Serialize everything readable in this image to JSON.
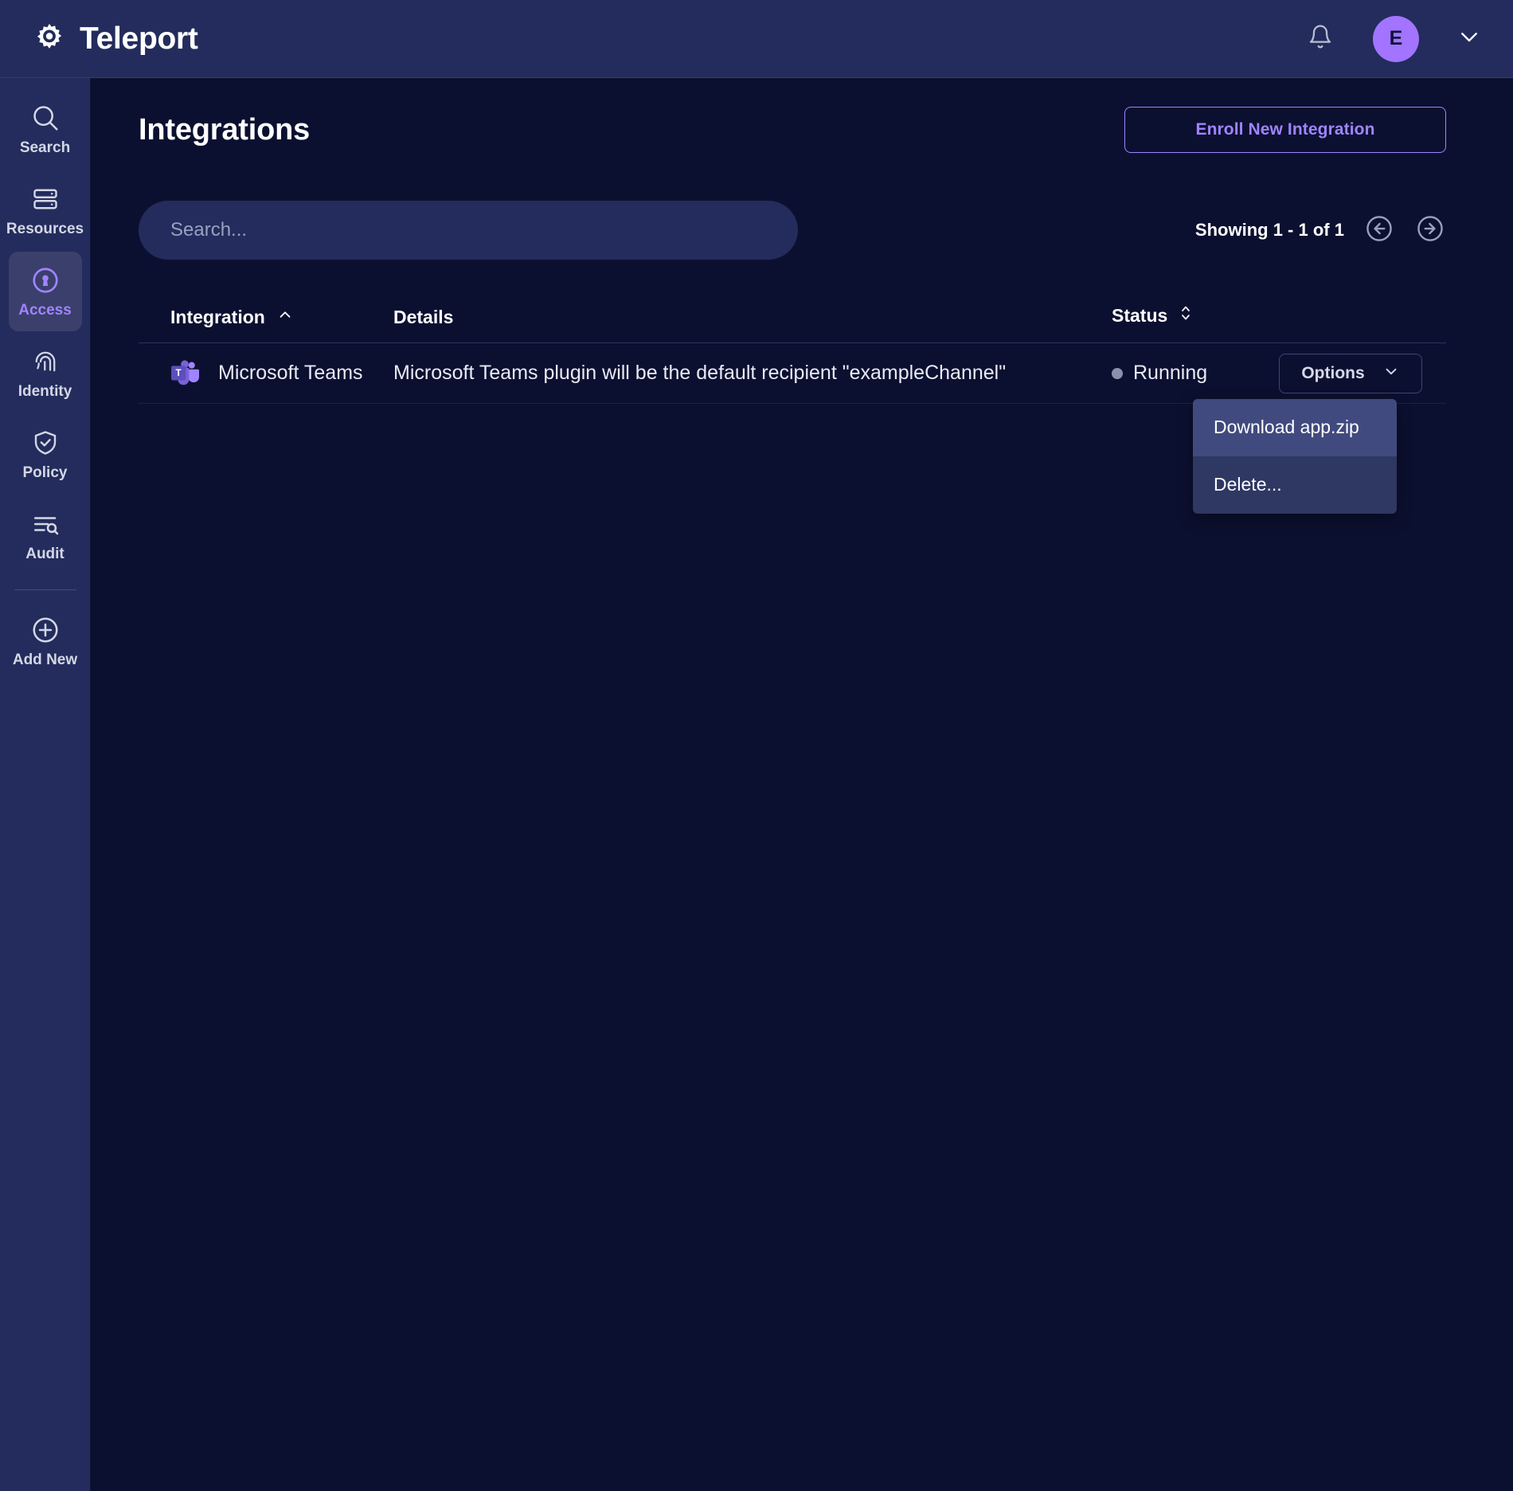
{
  "brand": {
    "name": "Teleport",
    "logo_icon": "gear-icon"
  },
  "topbar": {
    "notifications_icon": "bell-icon",
    "avatar_initial": "E",
    "account_chevron_icon": "chevron-down-icon"
  },
  "sidebar": {
    "items": [
      {
        "label": "Search",
        "icon": "search-icon",
        "active": false
      },
      {
        "label": "Resources",
        "icon": "server-icon",
        "active": false
      },
      {
        "label": "Access",
        "icon": "lock-circle-icon",
        "active": true
      },
      {
        "label": "Identity",
        "icon": "fingerprint-icon",
        "active": false
      },
      {
        "label": "Policy",
        "icon": "shield-check-icon",
        "active": false
      },
      {
        "label": "Audit",
        "icon": "list-search-icon",
        "active": false
      },
      {
        "label": "Add New",
        "icon": "plus-circle-icon",
        "active": false
      }
    ]
  },
  "page": {
    "title": "Integrations",
    "enroll_button": "Enroll New Integration"
  },
  "search": {
    "placeholder": "Search...",
    "value": ""
  },
  "pagination": {
    "showing_prefix": "Showing",
    "range": "1 - 1",
    "of_word": "of",
    "total": "1",
    "prev_icon": "arrow-left-circle-icon",
    "next_icon": "arrow-right-circle-icon"
  },
  "table": {
    "columns": [
      {
        "label": "Integration",
        "sort": "asc",
        "sort_icon": "chevron-up-icon"
      },
      {
        "label": "Details",
        "sort": "none",
        "sort_icon": ""
      },
      {
        "label": "Status",
        "sort": "none",
        "sort_icon": "chevron-updown-icon"
      }
    ],
    "rows": [
      {
        "integration": "Microsoft Teams",
        "integration_icon": "microsoft-teams-icon",
        "details": "Microsoft Teams plugin will be the default recipient \"exampleChannel\"",
        "status": "Running",
        "status_color": "#8b91ad",
        "options_label": "Options",
        "options_chevron_icon": "chevron-down-icon"
      }
    ]
  },
  "options_menu": {
    "open": true,
    "items": [
      {
        "label": "Download app.zip",
        "hovered": true
      },
      {
        "label": "Delete...",
        "hovered": false
      }
    ]
  },
  "colors": {
    "topbar_bg": "#232c5c",
    "sidebar_bg": "#232c5c",
    "content_bg": "#0c1030",
    "accent_purple": "#9f85ff",
    "avatar_bg": "#a274ff",
    "menu_bg": "#2f3763",
    "menu_hover_bg": "#414a7e",
    "status_dot": "#8b91ad"
  }
}
